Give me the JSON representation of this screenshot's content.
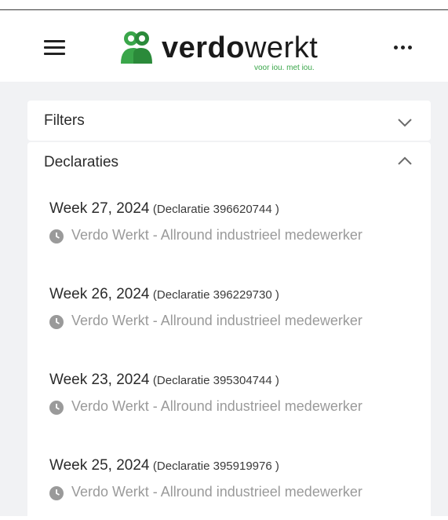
{
  "header": {
    "menu_icon": "hamburger-icon",
    "logo": {
      "word_bold": "verdo",
      "word_light": "werkt",
      "tagline": "voor iou. met iou.",
      "brand_color": "#3aa64a"
    },
    "more_icon": "more-horizontal-icon"
  },
  "filters": {
    "title": "Filters",
    "chevron_icon": "chevron-down-icon",
    "expanded": false
  },
  "declaraties": {
    "title": "Declaraties",
    "chevron_icon": "chevron-up-icon",
    "expanded": true,
    "items": [
      {
        "week": "Week 27, 2024",
        "declaratie": "(Declaratie 396620744 )",
        "description": "Verdo Werkt - Allround industrieel medewerker"
      },
      {
        "week": "Week 26, 2024",
        "declaratie": "(Declaratie 396229730 )",
        "description": "Verdo Werkt - Allround industrieel medewerker"
      },
      {
        "week": "Week 23, 2024",
        "declaratie": "(Declaratie 395304744 )",
        "description": "Verdo Werkt - Allround industrieel medewerker"
      },
      {
        "week": "Week 25, 2024",
        "declaratie": "(Declaratie 395919976 )",
        "description": "Verdo Werkt - Allround industrieel medewerker"
      }
    ],
    "item_icon": "clock-icon"
  },
  "colors": {
    "background": "#f1f2f4",
    "card": "#ffffff",
    "text": "#2b2b2b",
    "muted": "#9a9a9a",
    "brand_green": "#3aa64a"
  }
}
